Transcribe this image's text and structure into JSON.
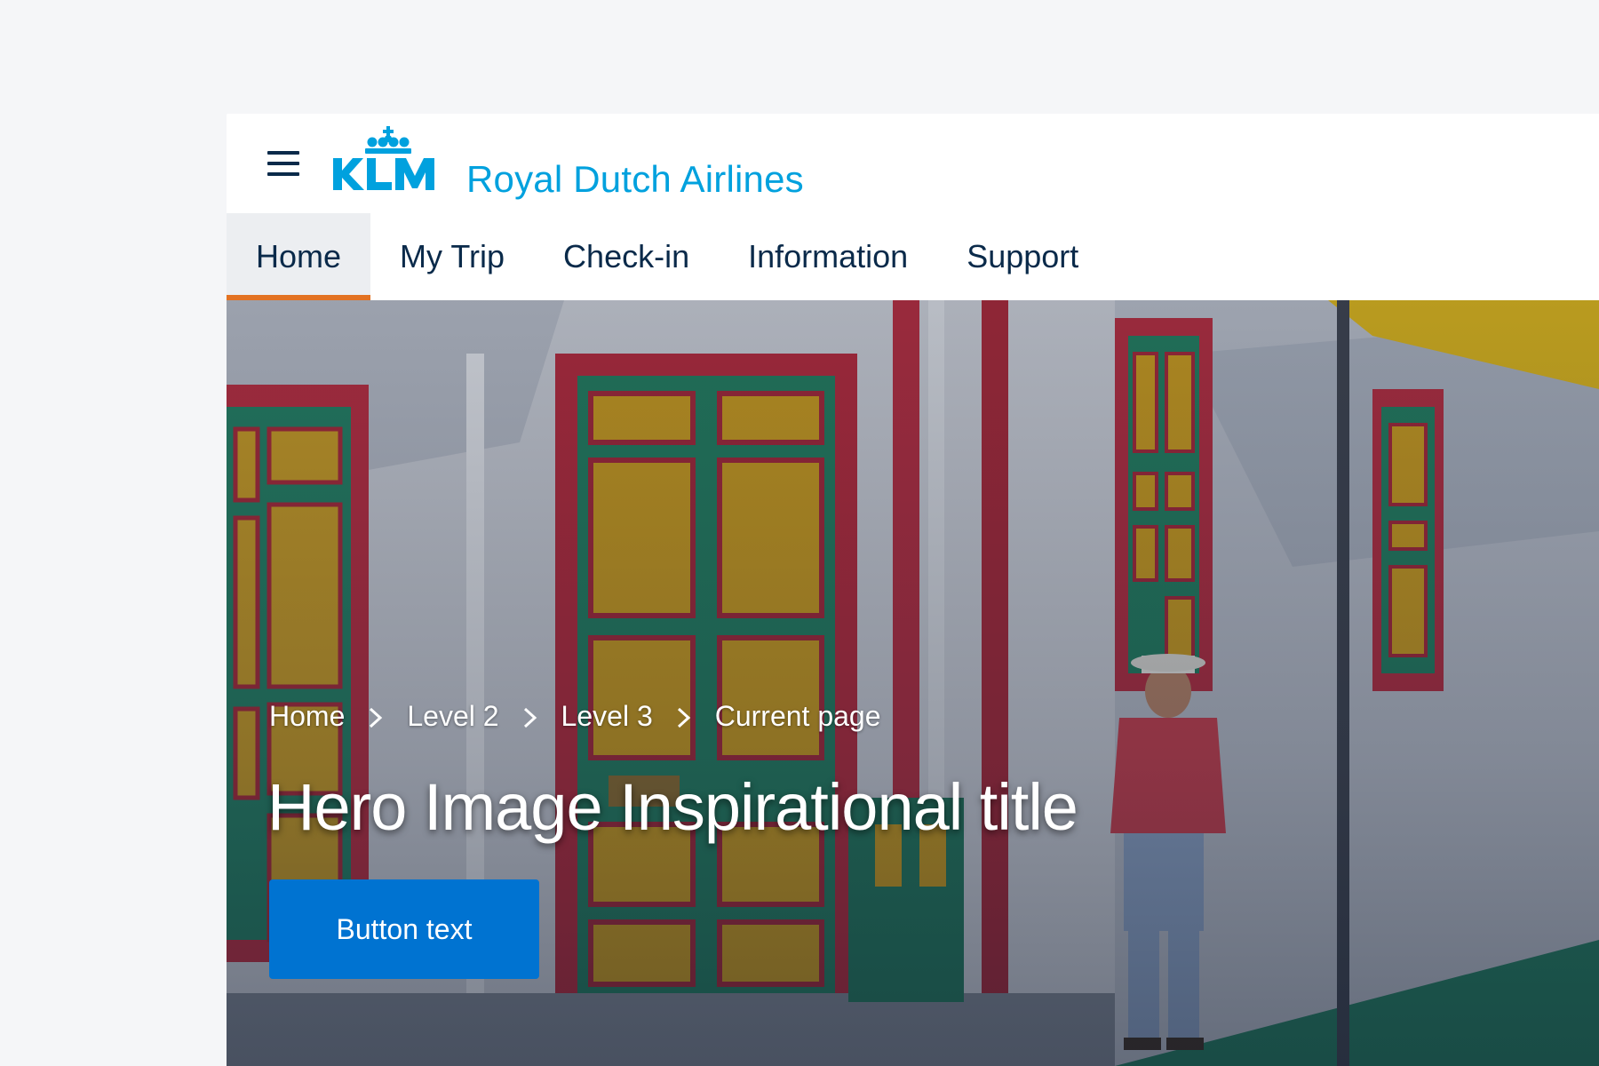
{
  "header": {
    "brand_text": "Royal Dutch Airlines",
    "logo_text": "KLM",
    "menu_icon": "hamburger-menu-icon"
  },
  "nav": {
    "tabs": [
      {
        "label": "Home",
        "active": true
      },
      {
        "label": "My Trip",
        "active": false
      },
      {
        "label": "Check-in",
        "active": false
      },
      {
        "label": "Information",
        "active": false
      },
      {
        "label": "Support",
        "active": false
      }
    ]
  },
  "hero": {
    "breadcrumb": [
      "Home",
      "Level 2",
      "Level 3",
      "Current page"
    ],
    "title": "Hero Image Inspirational title",
    "button_label": "Button text"
  },
  "colors": {
    "brand_blue": "#00a1de",
    "nav_text": "#0a2a4a",
    "active_indicator": "#e37222",
    "button_blue": "#0073d1",
    "page_bg": "#f5f6f8"
  }
}
